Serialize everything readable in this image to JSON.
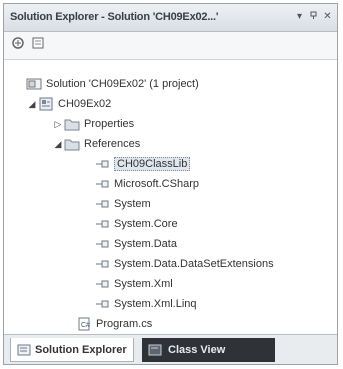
{
  "window": {
    "title": "Solution Explorer - Solution 'CH09Ex02...' ",
    "controls": [
      "pin",
      "auto-hide",
      "close"
    ]
  },
  "toolbar": {
    "buttons": [
      {
        "name": "properties",
        "icon": "properties-icon"
      },
      {
        "name": "show-all-files",
        "icon": "show-all-files-icon"
      }
    ]
  },
  "tree": {
    "solution": "Solution 'CH09Ex02' (1 project)",
    "project": "CH09Ex02",
    "properties": "Properties",
    "references": "References",
    "reference_items": [
      "CH09ClassLib",
      "Microsoft.CSharp",
      "System",
      "System.Core",
      "System.Data",
      "System.Data.DataSetExtensions",
      "System.Xml",
      "System.Xml.Linq"
    ],
    "program": "Program.cs"
  },
  "tabs": {
    "solution_explorer": "Solution Explorer",
    "class_view": "Class View"
  },
  "colors": {
    "selection": "#dfe6ee",
    "active_tab": "#ffffff",
    "inactive_tab": "#2f3338"
  }
}
